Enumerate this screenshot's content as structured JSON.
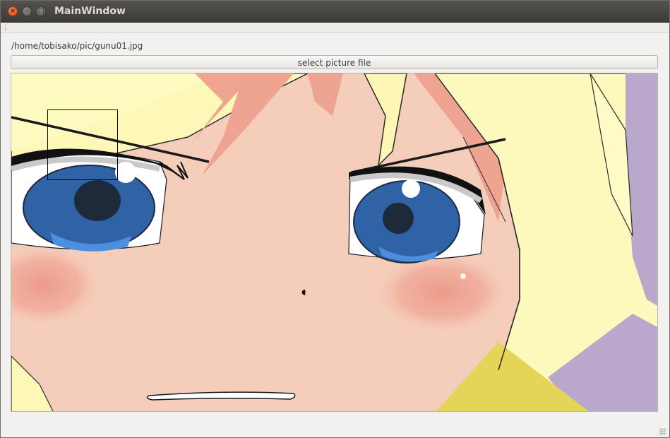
{
  "window": {
    "title": "MainWindow"
  },
  "controls": {
    "close_glyph": "×",
    "minimize_glyph": "–",
    "maximize_glyph": "□"
  },
  "file": {
    "path": "/home/tobisako/pic/gunu01.jpg"
  },
  "actions": {
    "select_label": "select picture file"
  },
  "image": {
    "subject": "anime-face-closeup"
  },
  "colors": {
    "titlebar": "#3c3b37",
    "window_bg": "#f2f1f0",
    "close": "#e95420"
  }
}
